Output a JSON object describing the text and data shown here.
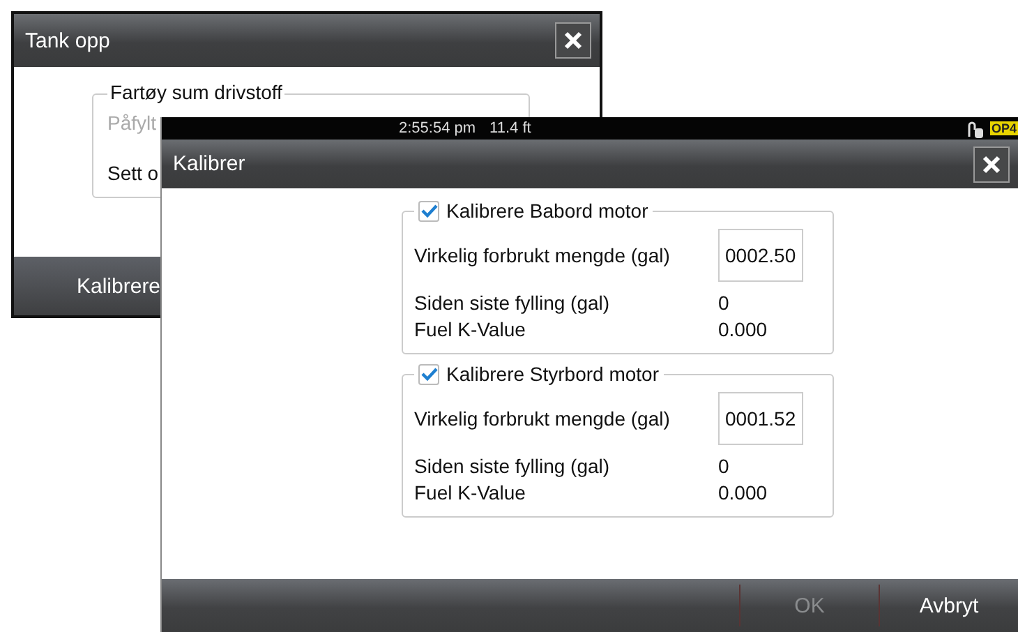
{
  "back_dialog": {
    "title": "Tank opp",
    "group": {
      "title": "Fartøy sum drivstoff",
      "rows": [
        {
          "label": "Påfylt",
          "disabled": true
        },
        {
          "label": "Sett o",
          "disabled": false
        }
      ]
    },
    "buttons": [
      {
        "label": "Kalibrere"
      }
    ]
  },
  "status_bar": {
    "time": "2:55:54 pm",
    "depth": "11.4 ft",
    "badge": "OP4"
  },
  "dialog": {
    "title": "Kalibrer",
    "groups": [
      {
        "title": "Kalibrere Babord motor",
        "checked": true,
        "rows": [
          {
            "kind": "input",
            "label": "Virkelig forbrukt mengde (gal)",
            "value": "0002.50"
          },
          {
            "kind": "text",
            "label": "Siden siste fylling (gal)",
            "value": "0"
          },
          {
            "kind": "text",
            "label": "Fuel K-Value",
            "value": "0.000"
          }
        ]
      },
      {
        "title": "Kalibrere Styrbord motor",
        "checked": true,
        "rows": [
          {
            "kind": "input",
            "label": "Virkelig forbrukt mengde (gal)",
            "value": "0001.52"
          },
          {
            "kind": "text",
            "label": "Siden siste fylling (gal)",
            "value": "0"
          },
          {
            "kind": "text",
            "label": "Fuel K-Value",
            "value": "0.000"
          }
        ]
      }
    ],
    "buttons": [
      {
        "label": "OK",
        "disabled": true
      },
      {
        "label": "Avbryt",
        "disabled": false
      }
    ]
  }
}
